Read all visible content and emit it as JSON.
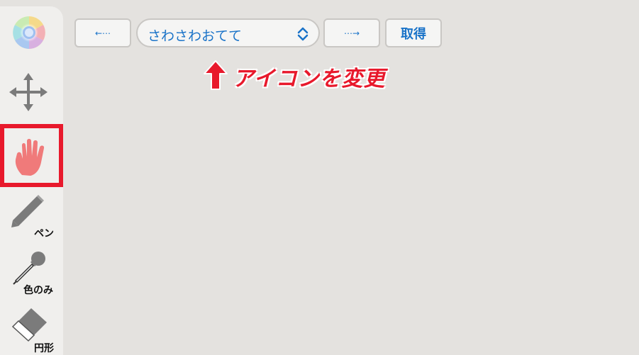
{
  "toolbar": {
    "prev_label": "⋯",
    "select_value": "さわさわおてて",
    "next_label": "⋯",
    "get_label": "取得"
  },
  "annotation": {
    "text": "アイコンを変更",
    "color": "#e8192c"
  },
  "sidebar": {
    "tools": [
      {
        "icon": "color-wheel-icon",
        "label": ""
      },
      {
        "icon": "move-arrows-icon",
        "label": ""
      },
      {
        "icon": "hand-icon",
        "label": "",
        "selected": true
      },
      {
        "icon": "pen-icon",
        "label": "ペン"
      },
      {
        "icon": "dropper-icon",
        "label": "色のみ"
      },
      {
        "icon": "eraser-icon",
        "label": "円形"
      }
    ]
  },
  "colors": {
    "accent": "#1a73c8",
    "highlight": "#e8192c",
    "hand": "#f07a7a",
    "background": "#e4e2df"
  }
}
